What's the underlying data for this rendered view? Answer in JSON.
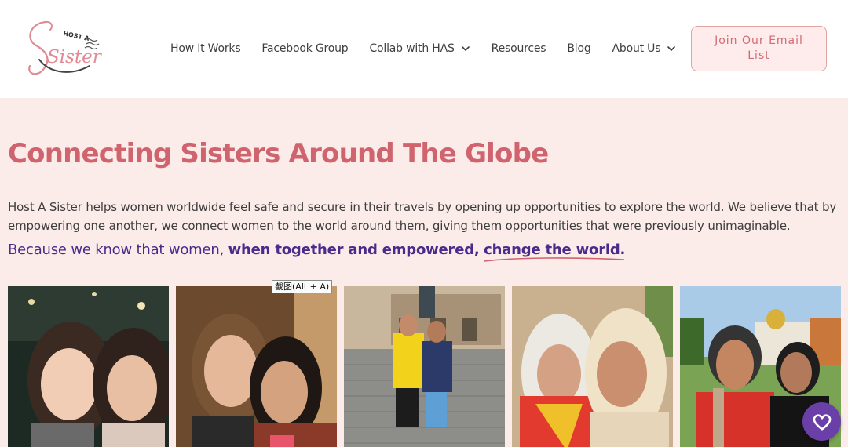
{
  "logo": {
    "top_word": "HOST A",
    "script_word": "Sister"
  },
  "nav": {
    "items": [
      {
        "label": "How It Works",
        "dropdown": false
      },
      {
        "label": "Facebook Group",
        "dropdown": false
      },
      {
        "label": "Collab with HAS",
        "dropdown": true
      },
      {
        "label": "Resources",
        "dropdown": false
      },
      {
        "label": "Blog",
        "dropdown": false
      },
      {
        "label": "About Us",
        "dropdown": true
      }
    ],
    "cta_label": "Join Our Email List"
  },
  "hero": {
    "title": "Connecting Sisters Around The Globe",
    "description": "Host A Sister helps women worldwide feel safe and secure in their travels by opening up opportunities to explore the world. We believe that by empowering one another, we connect women to the world around them, giving them opportunities that were previously unimaginable.",
    "tagline_part1": "Because we know that women,",
    "tagline_part2": "when together and empowered,",
    "tagline_part3": "change the world."
  },
  "tooltip": "截图(Alt + A)",
  "colors": {
    "accent": "#d0646e",
    "tagline": "#4a2a8a",
    "background": "#fbecea",
    "cta_border": "#e0a4a4",
    "fab": "#6a3fa8"
  },
  "icons": {
    "nav_dropdown": "chevron-down-icon",
    "fab": "heart-icon"
  }
}
